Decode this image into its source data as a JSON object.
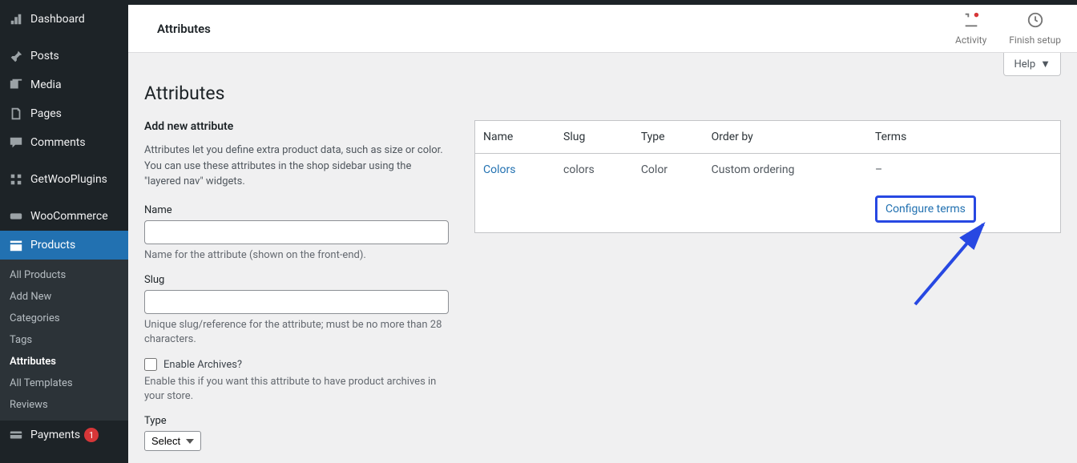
{
  "sidebar": {
    "items": [
      {
        "label": "Dashboard"
      },
      {
        "label": "Posts"
      },
      {
        "label": "Media"
      },
      {
        "label": "Pages"
      },
      {
        "label": "Comments"
      },
      {
        "label": "GetWooPlugins"
      },
      {
        "label": "WooCommerce"
      },
      {
        "label": "Products"
      },
      {
        "label": "Payments",
        "badge": "1"
      }
    ],
    "submenu": [
      {
        "label": "All Products"
      },
      {
        "label": "Add New"
      },
      {
        "label": "Categories"
      },
      {
        "label": "Tags"
      },
      {
        "label": "Attributes"
      },
      {
        "label": "All Templates"
      },
      {
        "label": "Reviews"
      }
    ]
  },
  "header": {
    "page_label": "Attributes",
    "activity_label": "Activity",
    "finish_label": "Finish setup"
  },
  "help_label": "Help",
  "page_title": "Attributes",
  "form": {
    "section_title": "Add new attribute",
    "intro": "Attributes let you define extra product data, such as size or color. You can use these attributes in the shop sidebar using the \"layered nav\" widgets.",
    "name_label": "Name",
    "name_desc": "Name for the attribute (shown on the front-end).",
    "slug_label": "Slug",
    "slug_desc": "Unique slug/reference for the attribute; must be no more than 28 characters.",
    "archives_label": "Enable Archives?",
    "archives_desc": "Enable this if you want this attribute to have product archives in your store.",
    "type_label": "Type",
    "type_selected": "Select"
  },
  "table": {
    "cols": {
      "name": "Name",
      "slug": "Slug",
      "type": "Type",
      "order": "Order by",
      "terms": "Terms"
    },
    "rows": [
      {
        "name": "Colors",
        "slug": "colors",
        "type": "Color",
        "order": "Custom ordering",
        "terms": "–"
      }
    ],
    "configure_label": "Configure terms"
  }
}
